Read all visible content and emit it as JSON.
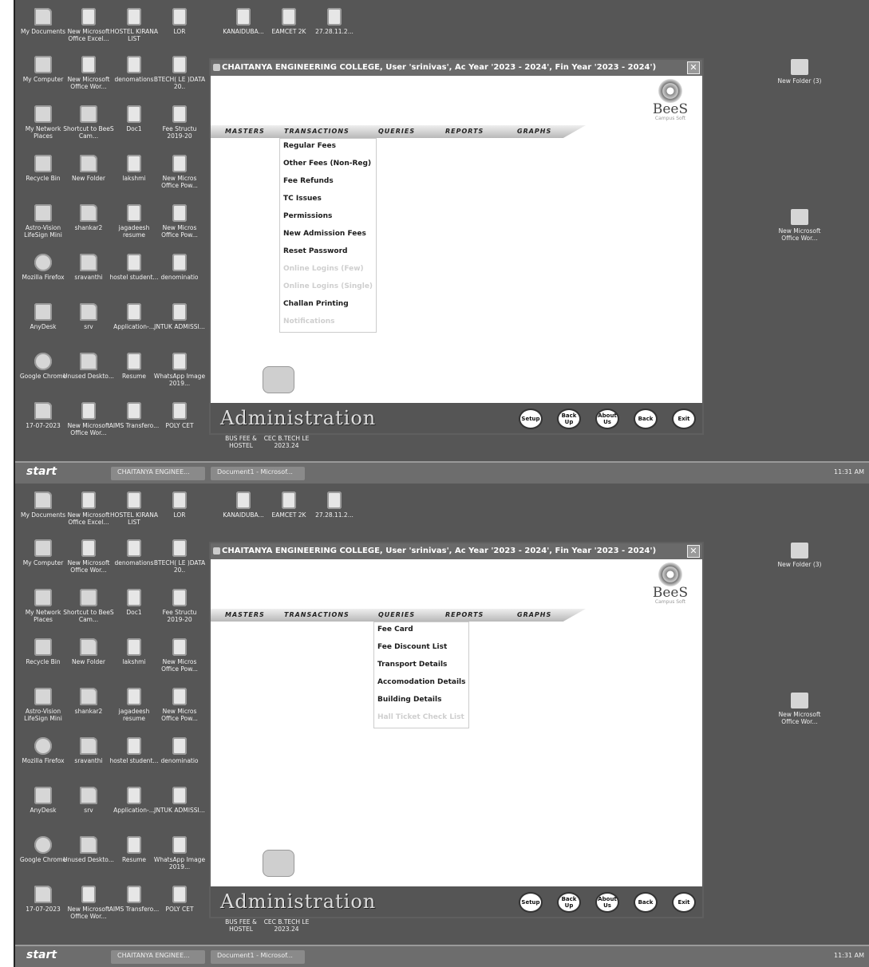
{
  "desktop_icons": [
    {
      "label": "My Documents",
      "kind": "folder"
    },
    {
      "label": "New Microsoft Office Excel...",
      "kind": "doc"
    },
    {
      "label": "HOSTEL KIRANA LIST",
      "kind": "doc"
    },
    {
      "label": "LOR",
      "kind": "doc"
    },
    {
      "label": "KANAIDUBA...",
      "kind": "doc"
    },
    {
      "label": "EAMCET 2K",
      "kind": "doc"
    },
    {
      "label": "27.28.11.2...",
      "kind": "doc"
    },
    {
      "label": "My Computer",
      "kind": "app"
    },
    {
      "label": "New Microsoft Office Wor...",
      "kind": "doc"
    },
    {
      "label": "denomations",
      "kind": "doc"
    },
    {
      "label": "BTECH( LE )DATA 20..",
      "kind": "doc"
    },
    {
      "label": "My Network Places",
      "kind": "app"
    },
    {
      "label": "Shortcut to BeeS Cam...",
      "kind": "app"
    },
    {
      "label": "Doc1",
      "kind": "doc"
    },
    {
      "label": "Fee Structu 2019-20",
      "kind": "doc"
    },
    {
      "label": "Recycle Bin",
      "kind": "app"
    },
    {
      "label": "New Folder",
      "kind": "folder"
    },
    {
      "label": "lakshmi",
      "kind": "doc"
    },
    {
      "label": "New Micros Office Pow...",
      "kind": "doc"
    },
    {
      "label": "Astro-Vision LifeSign Mini",
      "kind": "app"
    },
    {
      "label": "shankar2",
      "kind": "folder"
    },
    {
      "label": "jagadeesh resume",
      "kind": "doc"
    },
    {
      "label": "New Micros Office Pow...",
      "kind": "doc"
    },
    {
      "label": "Mozilla Firefox",
      "kind": "round"
    },
    {
      "label": "sravanthi",
      "kind": "folder"
    },
    {
      "label": "hostel student...",
      "kind": "doc"
    },
    {
      "label": "denominatio",
      "kind": "doc"
    },
    {
      "label": "AnyDesk",
      "kind": "app"
    },
    {
      "label": "srv",
      "kind": "folder"
    },
    {
      "label": "Application-...",
      "kind": "doc"
    },
    {
      "label": "JNTUK ADMISSI...",
      "kind": "doc"
    },
    {
      "label": "Google Chrome",
      "kind": "round"
    },
    {
      "label": "Unused Deskto...",
      "kind": "folder"
    },
    {
      "label": "Resume",
      "kind": "doc"
    },
    {
      "label": "WhatsApp Image 2019...",
      "kind": "doc"
    },
    {
      "label": "17-07-2023",
      "kind": "folder"
    },
    {
      "label": "New Microsoft Office Wor...",
      "kind": "doc"
    },
    {
      "label": "AIMS Transfero...",
      "kind": "doc"
    },
    {
      "label": "POLY CET",
      "kind": "doc"
    },
    {
      "label": "BUS FEE & HOSTEL",
      "kind": "doc"
    },
    {
      "label": "CEC B.TECH LE 2023.24",
      "kind": "doc"
    }
  ],
  "right_icons": [
    {
      "label": "New Folder (3)",
      "kind": "folder"
    },
    {
      "label": "New Microsoft Office Wor...",
      "kind": "doc"
    }
  ],
  "window": {
    "title": "CHAITANYA ENGINEERING COLLEGE, User 'srinivas', Ac Year '2023 - 2024', Fin Year '2023 - 2024')",
    "close": "✕",
    "logo_main": "BeeS",
    "logo_sub": "Campus Soft",
    "menu": [
      "MASTERS",
      "TRANSACTIONS",
      "QUERIES",
      "REPORTS",
      "GRAPHS"
    ],
    "footer_title": "Administration",
    "buttons": [
      "Setup",
      "Back Up",
      "About Us",
      "Back",
      "Exit"
    ]
  },
  "transactions_menu": [
    {
      "label": "Regular Fees",
      "enabled": true
    },
    {
      "label": "Other Fees (Non-Reg)",
      "enabled": true
    },
    {
      "label": "Fee Refunds",
      "enabled": true
    },
    {
      "label": "TC Issues",
      "enabled": true
    },
    {
      "label": "Permissions",
      "enabled": true
    },
    {
      "label": "New Admission Fees",
      "enabled": true
    },
    {
      "label": "Reset Password",
      "enabled": true
    },
    {
      "label": "Online Logins (Few)",
      "enabled": false
    },
    {
      "label": "Online Logins (Single)",
      "enabled": false
    },
    {
      "label": "Challan Printing",
      "enabled": true
    },
    {
      "label": "Notifications",
      "enabled": false
    }
  ],
  "queries_menu": [
    {
      "label": "Fee Card",
      "enabled": true
    },
    {
      "label": "Fee Discount List",
      "enabled": true
    },
    {
      "label": "Transport Details",
      "enabled": true
    },
    {
      "label": "Accomodation Details",
      "enabled": true
    },
    {
      "label": "Building Details",
      "enabled": true
    },
    {
      "label": "Hall Ticket Check List",
      "enabled": false
    }
  ],
  "taskbar": {
    "start": "start",
    "tasks": [
      "CHAITANYA ENGINEE...",
      "Document1 - Microsof..."
    ],
    "clock": "11:31 AM"
  }
}
